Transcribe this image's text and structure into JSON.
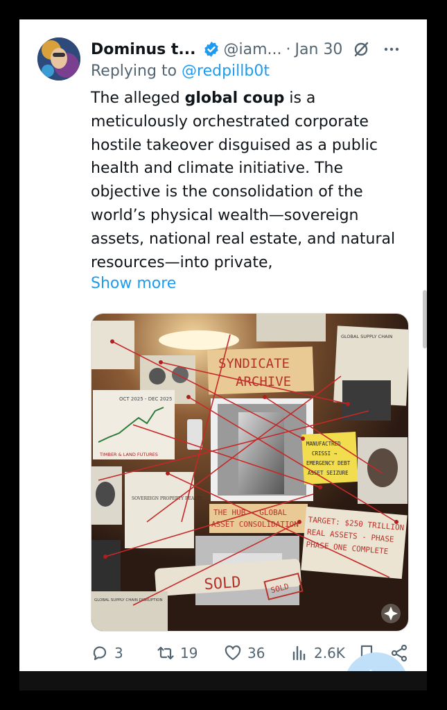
{
  "post": {
    "display_name": "Dominus t...",
    "handle": "@iam...",
    "separator": "·",
    "date": "Jan 30",
    "replying_prefix": "Replying to ",
    "replying_to": "@redpillb0t",
    "text_before": "The alleged ",
    "text_bold": "global coup",
    "text_after": " is a meticulously orchestrated corporate hostile takeover disguised as a public health and climate initiative. The objective is the consolidation of the world’s physical wealth—sovereign assets, national real estate, and natural resources—into private,",
    "show_more": "Show more"
  },
  "image": {
    "sign_line1": "SYNDICATE",
    "sign_line2": "ARCHIVE",
    "sticky_lines": [
      "MANUFACTRED",
      "CRISSI →",
      "EMERGENCY DEBT",
      "ASSET SEIZURE"
    ],
    "hub_line1": "THE HUB - GLOBAL",
    "hub_line2": "ASSET CONSOLIDATION",
    "target_lines": [
      "TARGET: $250 TRILLION",
      "REAL ASSETS - PHASE",
      "PHASE ONE COMPLETE"
    ],
    "sold_label": "SOLD",
    "sold_stamp": "SOLD",
    "chart_caption": "OCT 2025 - DEC 2025",
    "chart_footer": "TIMBER & LAND FUTURES",
    "doc_title": "SOVEREIGN PROPERTY REALTY",
    "news_title": "GLOBAL SUPPLY CHAIN",
    "bottom_doc": "GLOBAL SUPPLY CHAIN DISRUPTION"
  },
  "actions": {
    "replies": "3",
    "reposts": "19",
    "likes": "36",
    "views": "2.6K"
  },
  "colors": {
    "link": "#1d9bf0",
    "muted": "#536471",
    "text": "#0f1419"
  },
  "icons": [
    "verified-badge-icon",
    "grok-icon",
    "more-icon",
    "reply-icon",
    "repost-icon",
    "like-icon",
    "views-icon",
    "bookmark-icon",
    "share-icon",
    "compose-icon"
  ]
}
